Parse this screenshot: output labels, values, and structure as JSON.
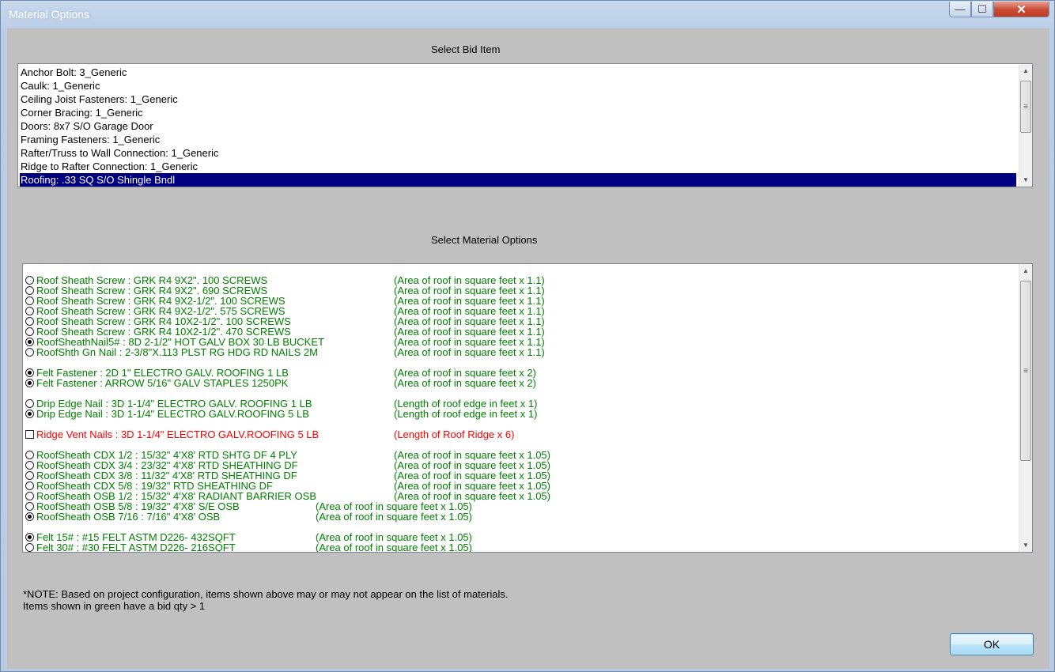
{
  "window": {
    "title": "Material Options",
    "controls": {
      "minimize": "—",
      "maximize": "☐",
      "close": "✕"
    }
  },
  "bid_section": {
    "label": "Select Bid Item",
    "items": [
      "Anchor Bolt: 3_Generic",
      "Caulk: 1_Generic",
      "Ceiling Joist Fasteners: 1_Generic",
      "Corner Bracing: 1_Generic",
      "Doors: 8x7 S/O Garage Door",
      "Framing Fasteners: 1_Generic",
      "Rafter/Truss to Wall Connection: 1_Generic",
      "Ridge to Rafter Connection: 1_Generic",
      "Roofing: .33 SQ S/O Shingle Bndl"
    ],
    "selected_index": 8
  },
  "material_section": {
    "label": "Select Material Options",
    "options": [
      {
        "text": "Roof Sheath Screw : GRK R4  9X2\". 100 SCREWS",
        "qty": "(Area of roof in square feet x 1.1)",
        "color": "#008000",
        "control": "radio",
        "checked": false
      },
      {
        "text": "Roof Sheath Screw : GRK R4  9X2\". 690 SCREWS",
        "qty": "(Area of roof in square feet x 1.1)",
        "color": "#008000",
        "control": "radio",
        "checked": false
      },
      {
        "text": "Roof Sheath Screw : GRK R4  9X2-1/2\". 100 SCREWS",
        "qty": "(Area of roof in square feet x 1.1)",
        "color": "#008000",
        "control": "radio",
        "checked": false
      },
      {
        "text": "Roof Sheath Screw : GRK R4  9X2-1/2\". 575 SCREWS",
        "qty": "(Area of roof in square feet x 1.1)",
        "color": "#008000",
        "control": "radio",
        "checked": false
      },
      {
        "text": "Roof Sheath Screw : GRK R4 10X2-1/2\". 100 SCREWS",
        "qty": "(Area of roof in square feet x 1.1)",
        "color": "#008000",
        "control": "radio",
        "checked": false
      },
      {
        "text": "Roof Sheath Screw : GRK R4 10X2-1/2\". 470 SCREWS",
        "qty": "(Area of roof in square feet x 1.1)",
        "color": "#008000",
        "control": "radio",
        "checked": false
      },
      {
        "text": "RoofSheathNail5# : 8D 2-1/2\" HOT GALV BOX 30 LB BUCKET",
        "qty": "(Area of roof in square feet x 1.1)",
        "color": "#008000",
        "control": "radio",
        "checked": true
      },
      {
        "text": "RoofShth Gn Nail : 2-3/8\"X.113 PLST RG HDG RD NAILS 2M",
        "qty": "(Area of roof in square feet x 1.1)",
        "color": "#008000",
        "control": "radio",
        "checked": false
      },
      {
        "text": "Felt Fastener : 2D 1\" ELECTRO GALV. ROOFING 1 LB",
        "qty": "(Area of roof in square feet x 2)",
        "color": "#008000",
        "control": "radio",
        "checked": true
      },
      {
        "text": "Felt Fastener : ARROW 5/16\" GALV STAPLES 1250PK",
        "qty": "(Area of roof in square feet x 2)",
        "color": "#008000",
        "control": "radio",
        "checked": true
      },
      {
        "text": "Drip Edge Nail : 3D 1-1/4\" ELECTRO GALV. ROOFING 1 LB",
        "qty": "(Length of roof edge in feet x 1)",
        "color": "#008000",
        "control": "radio",
        "checked": false
      },
      {
        "text": "Drip Edge Nail : 3D 1-1/4\" ELECTRO GALV.ROOFING 5 LB",
        "qty": "(Length of roof edge in feet x 1)",
        "color": "#008000",
        "control": "radio",
        "checked": true
      },
      {
        "text": "Ridge Vent Nails : 3D 1-1/4\" ELECTRO GALV.ROOFING 5 LB",
        "qty": "(Length of Roof Ridge  x 6)",
        "color": "#ff0000",
        "control": "checkbox",
        "checked": false
      },
      {
        "text": "RoofSheath CDX 1/2 : 15/32\" 4'X8' RTD SHTG DF 4 PLY",
        "qty": "(Area of roof in square feet x 1.05)",
        "color": "#008000",
        "control": "radio",
        "checked": false
      },
      {
        "text": "RoofSheath CDX 3/4 : 23/32\" 4'X8' RTD SHEATHING DF",
        "qty": "(Area of roof in square feet x 1.05)",
        "color": "#008000",
        "control": "radio",
        "checked": false
      },
      {
        "text": "RoofSheath CDX 3/8 : 11/32\" 4'X8' RTD SHEATHING DF",
        "qty": "(Area of roof in square feet x 1.05)",
        "color": "#008000",
        "control": "radio",
        "checked": false
      },
      {
        "text": "RoofSheath CDX 5/8 : 19/32\" RTD SHEATHING DF",
        "qty": "(Area of roof in square feet x 1.05)",
        "color": "#008000",
        "control": "radio",
        "checked": false
      },
      {
        "text": "RoofSheath OSB 1/2 : 15/32\" 4'X8' RADIANT BARRIER OSB",
        "qty": "(Area of roof in square feet x 1.05)",
        "color": "#008000",
        "control": "radio",
        "checked": false
      },
      {
        "text": "RoofSheath OSB 5/8 : 19/32\" 4'X8' S/E OSB",
        "qty": "(Area of roof in square feet x 1.05)",
        "color": "#008000",
        "control": "radio",
        "checked": false
      },
      {
        "text": "RoofSheath OSB 7/16 : 7/16\" 4'X8' OSB",
        "qty": "(Area of roof in square feet x 1.05)",
        "color": "#008000",
        "control": "radio",
        "checked": true
      },
      {
        "text": "Felt 15# : #15 FELT ASTM D226- 432SQFT",
        "qty": "(Area of roof in square feet x 1.05)",
        "color": "#008000",
        "control": "radio",
        "checked": true
      },
      {
        "text": "Felt 30# : #30 FELT ASTM D226- 216SQFT",
        "qty": "(Area of roof in square feet x 1.05)",
        "color": "#008000",
        "control": "radio",
        "checked": false
      }
    ]
  },
  "notes": {
    "line1": "*NOTE:  Based on project configuration, items shown above may or may not appear on the list of materials.",
    "line2": "Items shown in green have a bid qty > 1"
  },
  "buttons": {
    "ok": "OK"
  }
}
